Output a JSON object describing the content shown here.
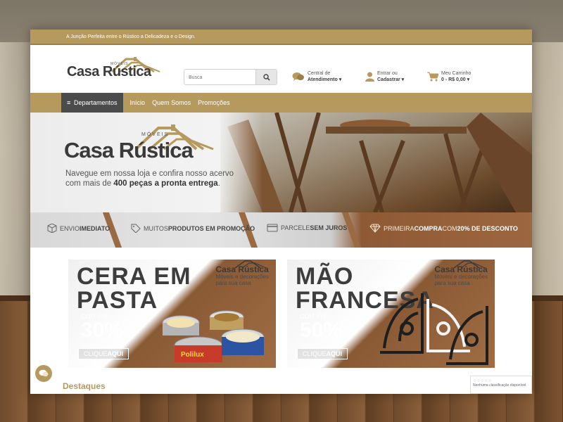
{
  "topbar": {
    "tagline": "A Junção Perfeita entre o Rústico a Delicadeza e o Design."
  },
  "header": {
    "logo_small": "MÓVEIS",
    "logo_text": "Casa Rústica",
    "search_placeholder": "Busca",
    "support": {
      "line1": "Central de",
      "line2": "Atendimento"
    },
    "account": {
      "line1": "Entrar ou",
      "line2": "Cadastrar"
    },
    "cart": {
      "line1": "Meu Carrinho",
      "line2": "0 - R$ 0,00"
    }
  },
  "nav": {
    "departments_label": "Departamentos",
    "links": [
      "Início",
      "Quem Somos",
      "Promoções"
    ]
  },
  "hero": {
    "logo_small": "MÓVEIS",
    "logo_text": "Casa Rústica",
    "text_line1": "Navegue em nossa loja e confira nosso acervo",
    "text_line2_pre": "com mais de ",
    "text_line2_bold": "400 peças a pronta entrega",
    "text_line2_post": "."
  },
  "features": [
    {
      "light": "ENVIO ",
      "bold": "IMEDIATO",
      "icon": "box-icon"
    },
    {
      "light": "MUITOS ",
      "bold": "PRODUTOS EM PROMOÇÃO",
      "icon": "tag-icon"
    },
    {
      "light": "PARCELE ",
      "bold": "SEM JUROS",
      "icon": "credit-card-icon"
    },
    {
      "light": "PRIMEIRA ",
      "bold": "COMPRA",
      "light2": " COM ",
      "bold2": "20% DE DESCONTO",
      "icon": "diamond-icon"
    }
  ],
  "promos": [
    {
      "title_line1": "CERA EM",
      "title_line2": "PASTA",
      "brand": "Casa Rústica",
      "tag_line1": "Móveis e decorações",
      "tag_line2": "para sua casa",
      "com_ate": "COM ATÉ",
      "percent": "30%",
      "off": "OFF",
      "cta_light": "CLIQUE",
      "cta_bold": "AQUI",
      "can_label": "Polilux"
    },
    {
      "title_line1": "MÃO",
      "title_line2": "FRANCESA",
      "brand": "Casa Rústica",
      "tag_line1": "Móveis e decorações",
      "tag_line2": "para sua casa",
      "com_ate": "COM ATÉ",
      "percent": "50%",
      "off": "OFF",
      "cta_light": "CLIQUE",
      "cta_bold": "AQUI"
    }
  ],
  "destaques": "Destaques",
  "rating_widget": {
    "text": "Nenhuma classificação disponível"
  },
  "colors": {
    "gold": "#b69a5d",
    "dark": "#4b4b4b",
    "wood": "#8a5a35"
  }
}
